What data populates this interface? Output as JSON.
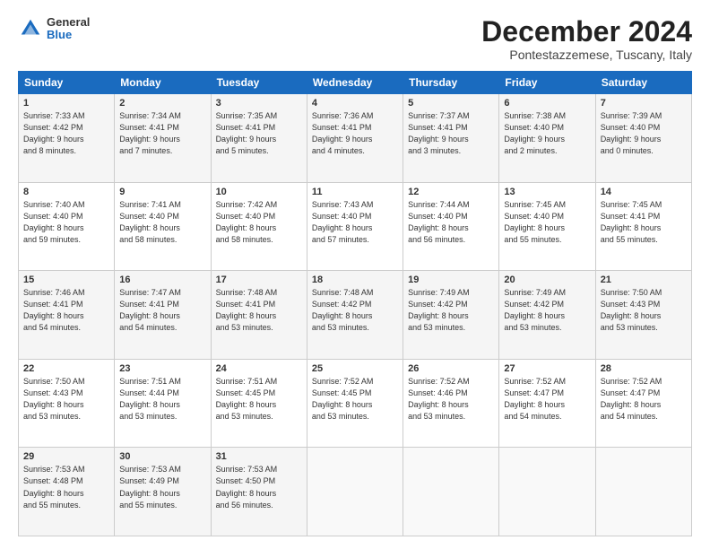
{
  "logo": {
    "general": "General",
    "blue": "Blue"
  },
  "header": {
    "title": "December 2024",
    "location": "Pontestazzemese, Tuscany, Italy"
  },
  "weekdays": [
    "Sunday",
    "Monday",
    "Tuesday",
    "Wednesday",
    "Thursday",
    "Friday",
    "Saturday"
  ],
  "weeks": [
    [
      {
        "day": "1",
        "info": "Sunrise: 7:33 AM\nSunset: 4:42 PM\nDaylight: 9 hours\nand 8 minutes."
      },
      {
        "day": "2",
        "info": "Sunrise: 7:34 AM\nSunset: 4:41 PM\nDaylight: 9 hours\nand 7 minutes."
      },
      {
        "day": "3",
        "info": "Sunrise: 7:35 AM\nSunset: 4:41 PM\nDaylight: 9 hours\nand 5 minutes."
      },
      {
        "day": "4",
        "info": "Sunrise: 7:36 AM\nSunset: 4:41 PM\nDaylight: 9 hours\nand 4 minutes."
      },
      {
        "day": "5",
        "info": "Sunrise: 7:37 AM\nSunset: 4:41 PM\nDaylight: 9 hours\nand 3 minutes."
      },
      {
        "day": "6",
        "info": "Sunrise: 7:38 AM\nSunset: 4:40 PM\nDaylight: 9 hours\nand 2 minutes."
      },
      {
        "day": "7",
        "info": "Sunrise: 7:39 AM\nSunset: 4:40 PM\nDaylight: 9 hours\nand 0 minutes."
      }
    ],
    [
      {
        "day": "8",
        "info": "Sunrise: 7:40 AM\nSunset: 4:40 PM\nDaylight: 8 hours\nand 59 minutes."
      },
      {
        "day": "9",
        "info": "Sunrise: 7:41 AM\nSunset: 4:40 PM\nDaylight: 8 hours\nand 58 minutes."
      },
      {
        "day": "10",
        "info": "Sunrise: 7:42 AM\nSunset: 4:40 PM\nDaylight: 8 hours\nand 58 minutes."
      },
      {
        "day": "11",
        "info": "Sunrise: 7:43 AM\nSunset: 4:40 PM\nDaylight: 8 hours\nand 57 minutes."
      },
      {
        "day": "12",
        "info": "Sunrise: 7:44 AM\nSunset: 4:40 PM\nDaylight: 8 hours\nand 56 minutes."
      },
      {
        "day": "13",
        "info": "Sunrise: 7:45 AM\nSunset: 4:40 PM\nDaylight: 8 hours\nand 55 minutes."
      },
      {
        "day": "14",
        "info": "Sunrise: 7:45 AM\nSunset: 4:41 PM\nDaylight: 8 hours\nand 55 minutes."
      }
    ],
    [
      {
        "day": "15",
        "info": "Sunrise: 7:46 AM\nSunset: 4:41 PM\nDaylight: 8 hours\nand 54 minutes."
      },
      {
        "day": "16",
        "info": "Sunrise: 7:47 AM\nSunset: 4:41 PM\nDaylight: 8 hours\nand 54 minutes."
      },
      {
        "day": "17",
        "info": "Sunrise: 7:48 AM\nSunset: 4:41 PM\nDaylight: 8 hours\nand 53 minutes."
      },
      {
        "day": "18",
        "info": "Sunrise: 7:48 AM\nSunset: 4:42 PM\nDaylight: 8 hours\nand 53 minutes."
      },
      {
        "day": "19",
        "info": "Sunrise: 7:49 AM\nSunset: 4:42 PM\nDaylight: 8 hours\nand 53 minutes."
      },
      {
        "day": "20",
        "info": "Sunrise: 7:49 AM\nSunset: 4:42 PM\nDaylight: 8 hours\nand 53 minutes."
      },
      {
        "day": "21",
        "info": "Sunrise: 7:50 AM\nSunset: 4:43 PM\nDaylight: 8 hours\nand 53 minutes."
      }
    ],
    [
      {
        "day": "22",
        "info": "Sunrise: 7:50 AM\nSunset: 4:43 PM\nDaylight: 8 hours\nand 53 minutes."
      },
      {
        "day": "23",
        "info": "Sunrise: 7:51 AM\nSunset: 4:44 PM\nDaylight: 8 hours\nand 53 minutes."
      },
      {
        "day": "24",
        "info": "Sunrise: 7:51 AM\nSunset: 4:45 PM\nDaylight: 8 hours\nand 53 minutes."
      },
      {
        "day": "25",
        "info": "Sunrise: 7:52 AM\nSunset: 4:45 PM\nDaylight: 8 hours\nand 53 minutes."
      },
      {
        "day": "26",
        "info": "Sunrise: 7:52 AM\nSunset: 4:46 PM\nDaylight: 8 hours\nand 53 minutes."
      },
      {
        "day": "27",
        "info": "Sunrise: 7:52 AM\nSunset: 4:47 PM\nDaylight: 8 hours\nand 54 minutes."
      },
      {
        "day": "28",
        "info": "Sunrise: 7:52 AM\nSunset: 4:47 PM\nDaylight: 8 hours\nand 54 minutes."
      }
    ],
    [
      {
        "day": "29",
        "info": "Sunrise: 7:53 AM\nSunset: 4:48 PM\nDaylight: 8 hours\nand 55 minutes."
      },
      {
        "day": "30",
        "info": "Sunrise: 7:53 AM\nSunset: 4:49 PM\nDaylight: 8 hours\nand 55 minutes."
      },
      {
        "day": "31",
        "info": "Sunrise: 7:53 AM\nSunset: 4:50 PM\nDaylight: 8 hours\nand 56 minutes."
      },
      {
        "day": "",
        "info": ""
      },
      {
        "day": "",
        "info": ""
      },
      {
        "day": "",
        "info": ""
      },
      {
        "day": "",
        "info": ""
      }
    ]
  ]
}
